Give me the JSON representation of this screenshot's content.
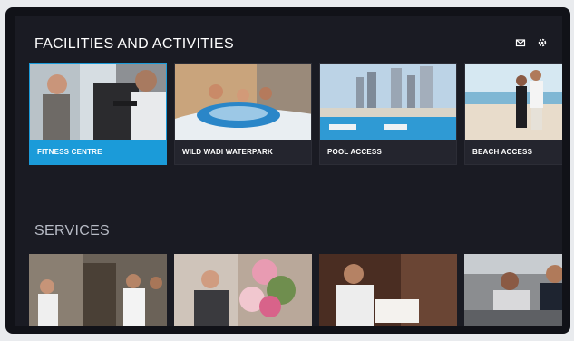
{
  "facilities": {
    "title": "FACILITIES AND ACTIVITIES",
    "tiles": [
      {
        "label": "FITNESS CENTRE",
        "selected": true
      },
      {
        "label": "WILD WADI WATERPARK",
        "selected": false
      },
      {
        "label": "POOL ACCESS",
        "selected": false
      },
      {
        "label": "BEACH ACCESS",
        "selected": false
      }
    ]
  },
  "services": {
    "title": "SERVICES"
  },
  "icons": [
    "mail-icon",
    "gear-icon"
  ],
  "colors": {
    "accent": "#1b9bd9",
    "background": "#1a1b23"
  }
}
